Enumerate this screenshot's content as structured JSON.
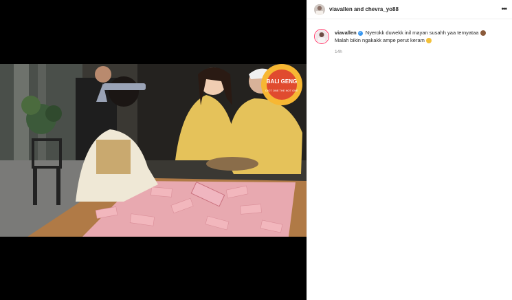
{
  "post": {
    "header_users": "viavallen and chevra_yo88",
    "more_icon": "more-horizontal-icon",
    "author": "viavallen",
    "caption_line1": "Nyerokk duwekk inil mayan susahh yaa ternyataa",
    "caption_line2": "Malah bikin ngakakk ampe perut keram",
    "time": "14h"
  },
  "video": {
    "badge_text": "BALI GENG",
    "badge_subtext": "DIOT ONE THE NOT ONE"
  },
  "colors": {
    "border": "#efefef",
    "text": "#262626",
    "muted": "#8e8e8e",
    "verified": "#3897f0"
  }
}
